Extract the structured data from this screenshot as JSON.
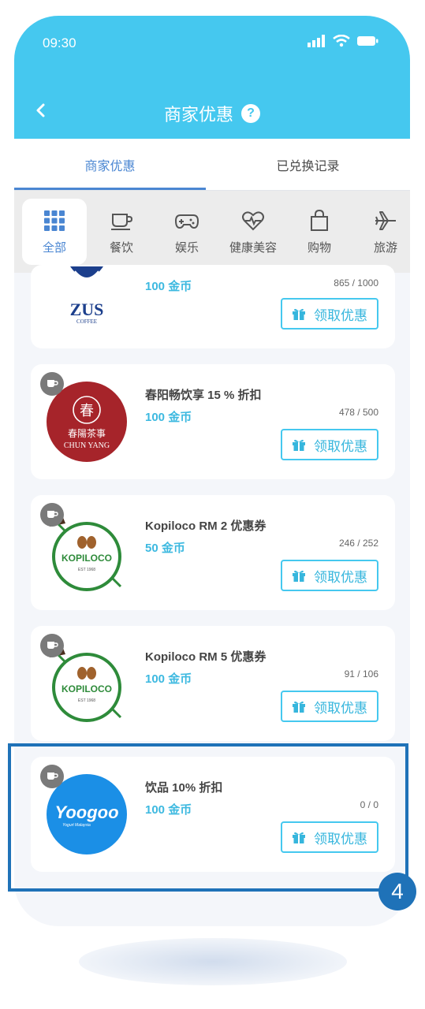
{
  "status": {
    "time": "09:30"
  },
  "header": {
    "title": "商家优惠",
    "help_icon": "?"
  },
  "tabs": [
    {
      "label": "商家优惠",
      "active": true
    },
    {
      "label": "已兑换记录",
      "active": false
    }
  ],
  "categories": [
    {
      "label": "全部",
      "icon": "grid-icon",
      "active": true
    },
    {
      "label": "餐饮",
      "icon": "cup-icon"
    },
    {
      "label": "娱乐",
      "icon": "gamepad-icon"
    },
    {
      "label": "健康美容",
      "icon": "heart-pulse-icon"
    },
    {
      "label": "购物",
      "icon": "shopping-bag-icon"
    },
    {
      "label": "旅游",
      "icon": "airplane-icon"
    }
  ],
  "offers": [
    {
      "name": "",
      "coins": "100 金币",
      "count": "865 / 1000",
      "button": "领取优惠",
      "logo": {
        "line1": "ZUS",
        "line2": "COFFEE"
      }
    },
    {
      "name": "春阳畅饮享 15 % 折扣",
      "coins": "100 金币",
      "count": "478 / 500",
      "button": "领取优惠",
      "logo": {
        "mark": "春",
        "line1": "春陽茶事",
        "line2": "CHUN YANG"
      }
    },
    {
      "name": "Kopiloco RM 2 优惠券",
      "coins": "50 金币",
      "count": "246 / 252",
      "button": "领取优惠",
      "logo": {
        "line1": "KOPILOCO",
        "line2": "EST 1968"
      }
    },
    {
      "name": "Kopiloco RM 5 优惠券",
      "coins": "100 金币",
      "count": "91 / 106",
      "button": "领取优惠",
      "logo": {
        "line1": "KOPILOCO",
        "line2": "EST 1968"
      }
    },
    {
      "name": "饮品 10% 折扣",
      "coins": "100 金币",
      "count": "0 / 0",
      "button": "领取优惠",
      "logo": {
        "line1": "Yoogoo",
        "line2": "Yogurt Malaysia"
      }
    }
  ],
  "annotation": {
    "step": "4"
  },
  "colors": {
    "header": "#45c8ef",
    "accent": "#4a86d2",
    "coin": "#3db9e0",
    "highlight": "#1f72b8"
  }
}
